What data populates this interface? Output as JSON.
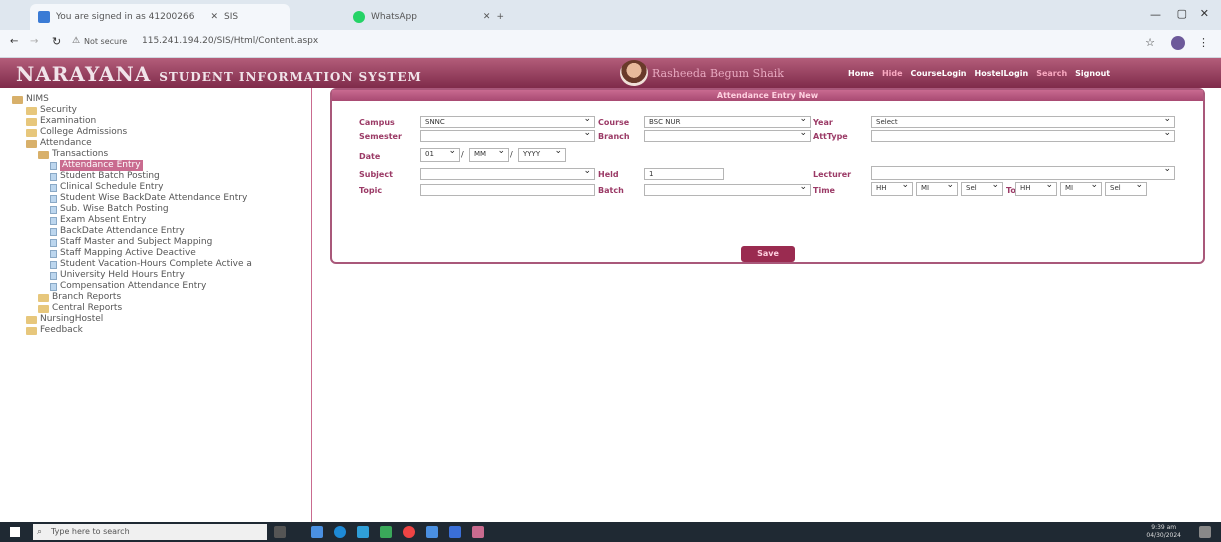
{
  "browser": {
    "tabs": [
      {
        "label": "You are signed in as 41200266"
      },
      {
        "label": "SIS"
      },
      {
        "label": "WhatsApp"
      }
    ],
    "not_secure": "Not secure",
    "url": "115.241.194.20/SIS/Html/Content.aspx"
  },
  "app": {
    "brand": "NARAYANA",
    "brand_sub": "STUDENT INFORMATION SYSTEM",
    "user_name": "Rasheeda Begum Shaik",
    "nav": [
      "Home",
      "Hide",
      "CourseLogin",
      "HostelLogin",
      "Search",
      "Signout"
    ]
  },
  "sidebar": {
    "root": "NIMS",
    "items": [
      "Security",
      "Examination",
      "College Admissions",
      "Attendance"
    ],
    "transactions": "Transactions",
    "leaves": [
      "Attendance Entry",
      "Student Batch Posting",
      "Clinical Schedule Entry",
      "Student Wise BackDate Attendance Entry",
      "Sub. Wise Batch Posting",
      "Exam Absent Entry",
      "BackDate Attendance Entry",
      "Staff Master and Subject Mapping",
      "Staff Mapping Active Deactive",
      "Student Vacation-Hours Complete Active a",
      "University Held Hours Entry",
      "Compensation Attendance Entry"
    ],
    "reports": [
      "Branch Reports",
      "Central Reports"
    ],
    "bottom": [
      "NursingHostel",
      "Feedback"
    ]
  },
  "form": {
    "title": "Attendance Entry New",
    "labels": {
      "campus": "Campus",
      "course": "Course",
      "year": "Year",
      "semester": "Semester",
      "branch": "Branch",
      "atttype": "AttType",
      "date": "Date",
      "subject": "Subject",
      "held": "Held",
      "lecturer": "Lecturer",
      "topic": "Topic",
      "batch": "Batch",
      "time": "Time",
      "to": "To"
    },
    "values": {
      "campus": "SNNC",
      "course": "BSC NUR",
      "year": "Select",
      "day": "01",
      "month": "MM",
      "yr": "YYYY",
      "held": "1",
      "hh1": "HH",
      "mi1": "MI",
      "sel1": "Sel",
      "hh2": "HH",
      "mi2": "MI",
      "sel2": "Sel"
    },
    "save": "Save"
  },
  "taskbar": {
    "search": "Type here to search",
    "time": "9:39 am",
    "date": "04/30/2024"
  }
}
